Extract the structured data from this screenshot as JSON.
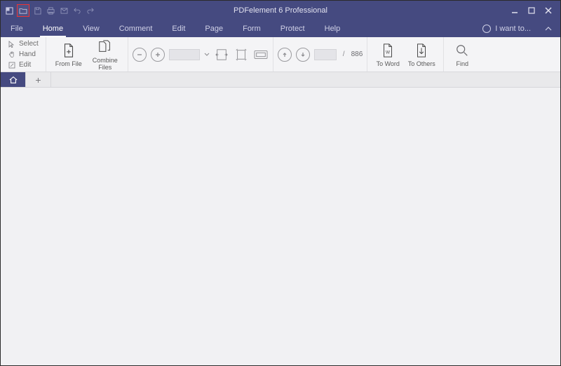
{
  "app": {
    "title": "PDFelement 6 Professional"
  },
  "menubar": {
    "items": [
      "File",
      "Home",
      "View",
      "Comment",
      "Edit",
      "Page",
      "Form",
      "Protect",
      "Help"
    ],
    "active_index": 1,
    "help_hint": "I want to..."
  },
  "ribbon": {
    "tools": {
      "select": "Select",
      "hand": "Hand",
      "edit": "Edit"
    },
    "from_file": "From File",
    "combine_files": "Combine\nFiles",
    "page_total": "886",
    "to_word": "To Word",
    "to_others": "To Others",
    "find": "Find"
  }
}
